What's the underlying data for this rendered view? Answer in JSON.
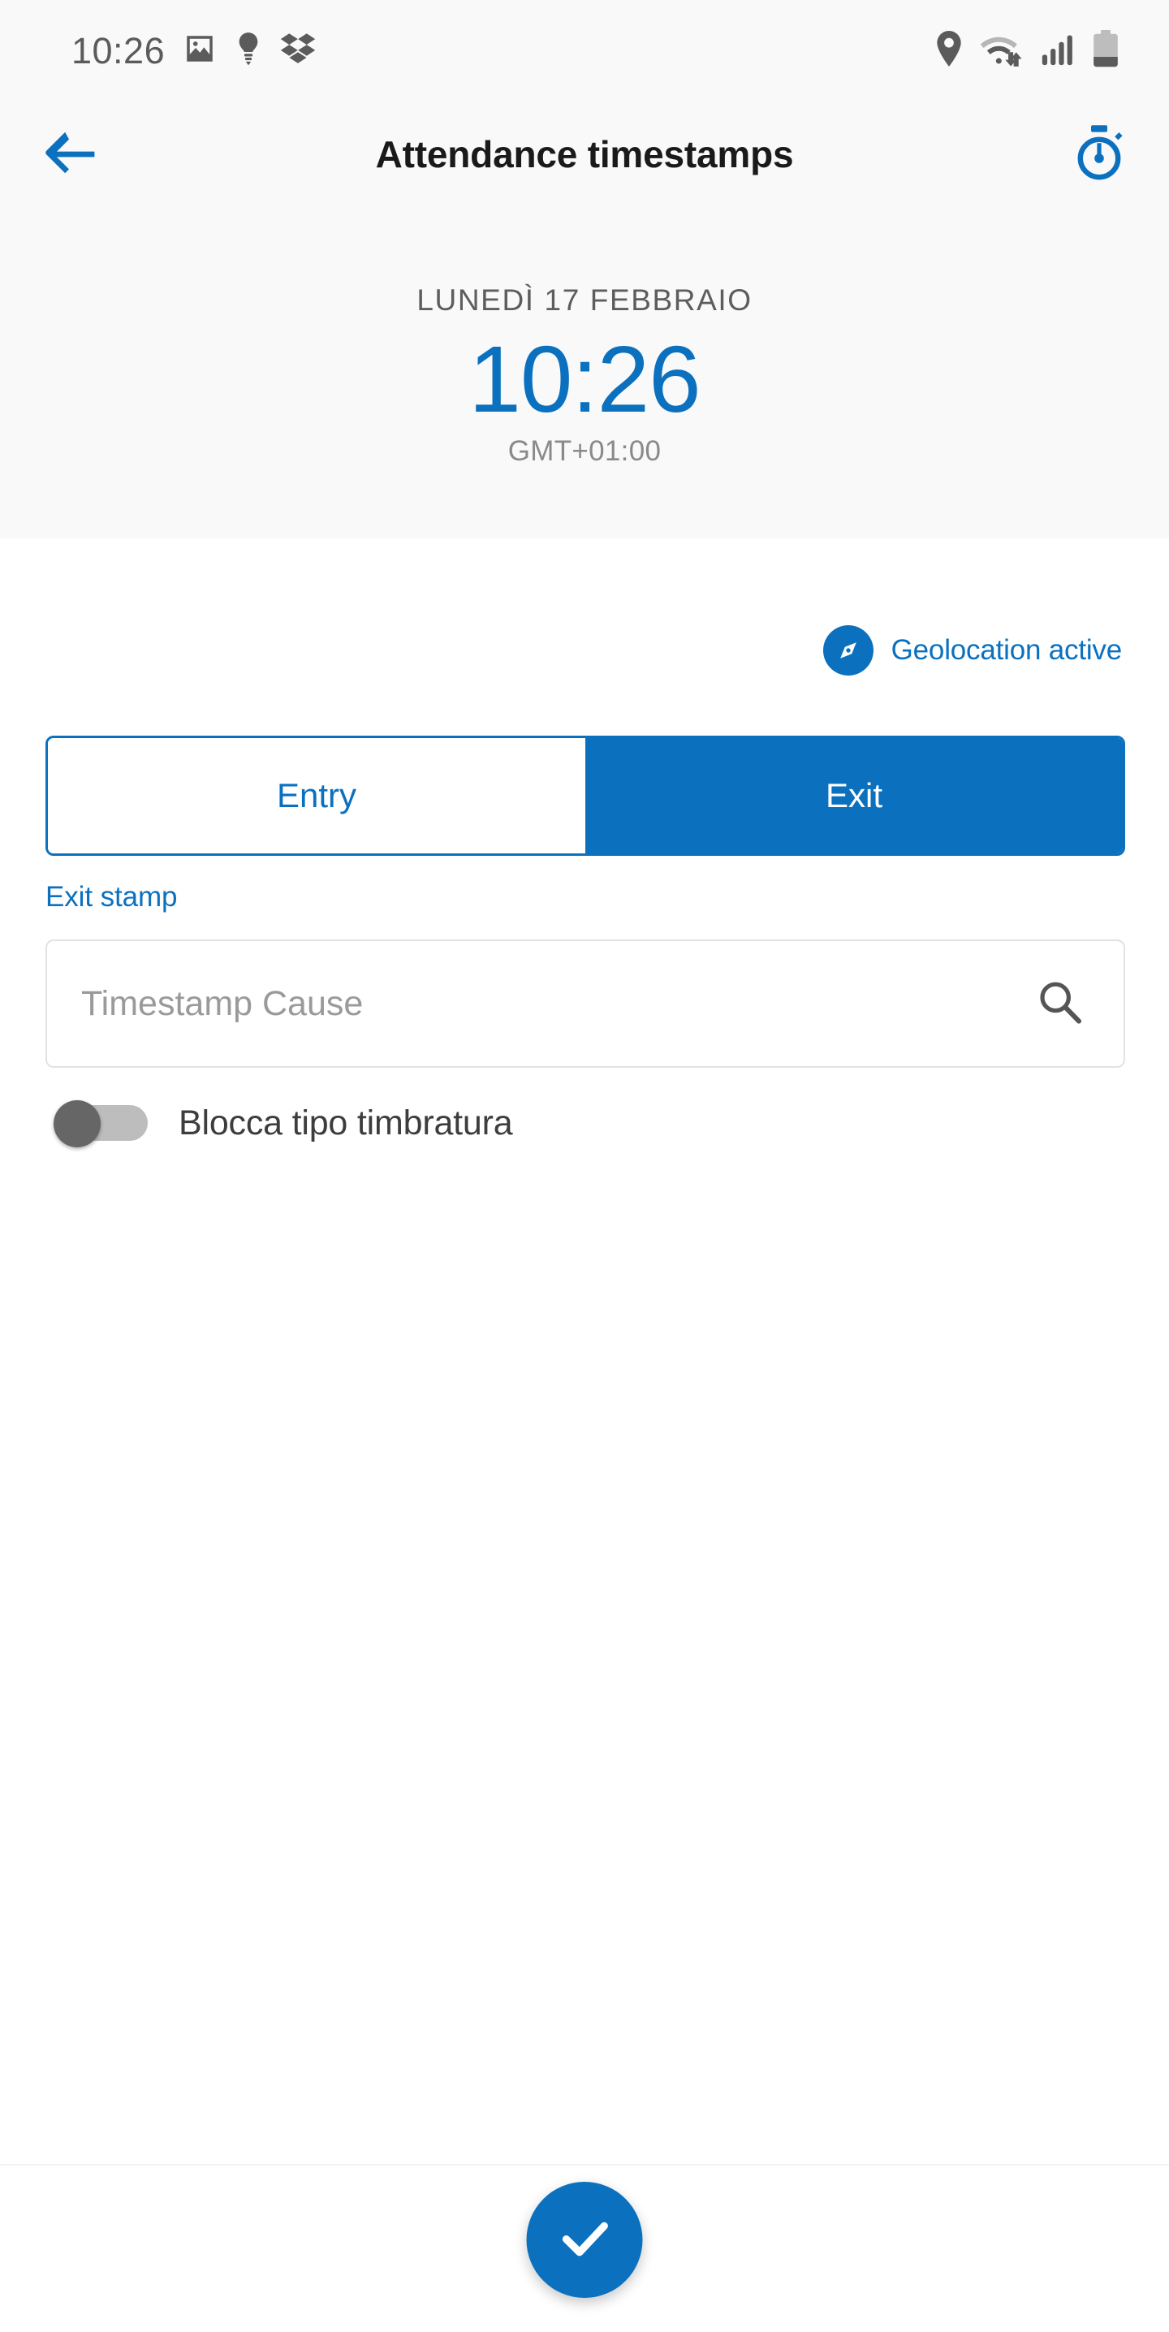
{
  "status_bar": {
    "time": "10:26",
    "left_icons": [
      "gallery-icon",
      "lightbulb-icon",
      "dropbox-icon"
    ],
    "right_icons": [
      "location-pin-icon",
      "wifi-icon",
      "cellular-signal-icon",
      "battery-icon"
    ]
  },
  "app_bar": {
    "back_icon": "back-arrow-icon",
    "title": "Attendance timestamps",
    "action_icon": "stopwatch-icon"
  },
  "clock_panel": {
    "date": "LUNEDÌ 17 FEBBRAIO",
    "time": "10:26",
    "timezone": "GMT+01:00"
  },
  "geolocation": {
    "icon": "compass-icon",
    "label": "Geolocation active"
  },
  "segmented_control": {
    "options": [
      {
        "label": "Entry",
        "selected": false
      },
      {
        "label": "Exit",
        "selected": true
      }
    ]
  },
  "stamp_form": {
    "field_label": "Exit stamp",
    "cause_placeholder": "Timestamp Cause",
    "cause_value": "",
    "search_icon": "search-icon"
  },
  "lock_toggle": {
    "label": "Blocca tipo timbratura",
    "state": "off"
  },
  "bottom_bar": {
    "confirm_icon": "check-icon"
  },
  "colors": {
    "brand_blue": "#0b71bf",
    "panel_gray": "#f9f9f9",
    "text_dark": "#3d3d3d",
    "text_muted": "#8a8a8a",
    "toggle_off_thumb": "#666666",
    "toggle_off_track": "#bdbdbd"
  }
}
